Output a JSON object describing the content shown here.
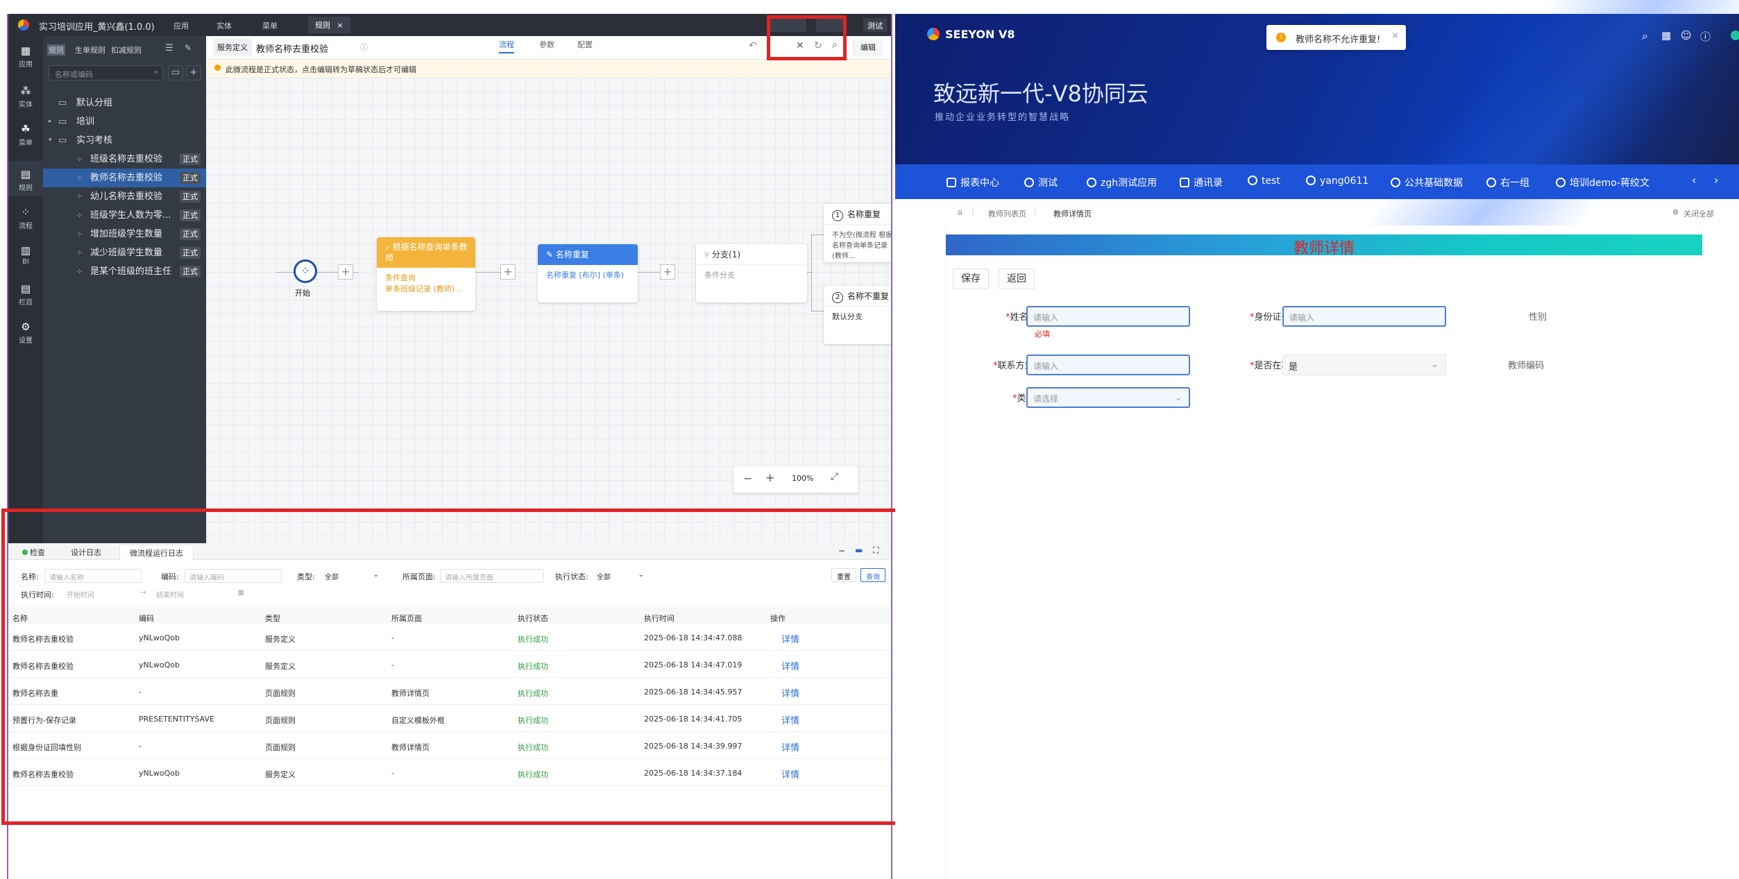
{
  "left_app": {
    "title": "实习培训应用_黄兴鑫(1.0.0)",
    "top_tabs": [
      "应用",
      "实体",
      "菜单",
      "规则"
    ],
    "active_top_tab": "规则",
    "top_right_btn": "测试",
    "rail": [
      "应用",
      "实体",
      "菜单",
      "规则",
      "流程",
      "BI",
      "栏目",
      "设置"
    ],
    "tree_tabs": [
      "规则",
      "生单规则",
      "扣减规则"
    ],
    "search_placeholder": "名称或编码",
    "groups": [
      "默认分组",
      "培训",
      "实习考核"
    ],
    "items": [
      {
        "label": "班级名称去重校验",
        "tag": "正式"
      },
      {
        "label": "教师名称去重校验",
        "tag": "正式"
      },
      {
        "label": "幼儿名称去重校验",
        "tag": "正式"
      },
      {
        "label": "班级学生人数为零...",
        "tag": "正式"
      },
      {
        "label": "增加班级学生数量",
        "tag": "正式"
      },
      {
        "label": "减少班级学生数量",
        "tag": "正式"
      },
      {
        "label": "是某个班级的班主任",
        "tag": "正式"
      }
    ]
  },
  "canvas": {
    "service_def": "服务定义",
    "name": "教师名称去重校验",
    "tabs": [
      "流程",
      "参数",
      "配置"
    ],
    "edit_btn": "编辑",
    "notice": "此微流程是正式状态，点击编辑转为草稿状态后才可编辑",
    "start_label": "开始",
    "node1_title": "根据名称查询单条教师",
    "node1_l1": "条件查询",
    "node1_l2": "单条班级记录 (教师)...",
    "node2_title": "名称重复",
    "node2_l1": "名称重复 [布尔] (单条)",
    "node3_title": "分支(1)",
    "node3_l1": "条件分支",
    "branch1_num": "1",
    "branch1_title": "名称重复",
    "branch1_body": "不为空(微流程 根据名称查询单条记录 (教师...",
    "branch2_num": "2",
    "branch2_title": "名称不重复",
    "branch2_body": "默认分支",
    "zoom": "100%"
  },
  "panel": {
    "tabs": [
      "检查",
      "设计日志",
      "微流程运行日志"
    ],
    "filters": {
      "name_label": "名称:",
      "name_ph": "请输入名称",
      "code_label": "编码:",
      "code_ph": "请输入编码",
      "type_label": "类型:",
      "type_val": "全部",
      "page_label": "所属页面:",
      "page_ph": "请输入所属页面",
      "status_label": "执行状态:",
      "status_val": "全部",
      "time_label": "执行时间:",
      "start_ph": "开始时间",
      "end_ph": "结束时间",
      "reset": "重置",
      "query": "查询"
    },
    "columns": [
      "名称",
      "编码",
      "类型",
      "所属页面",
      "执行状态",
      "执行时间",
      "操作"
    ],
    "rows": [
      [
        "教师名称去重校验",
        "yNLwoQob",
        "服务定义",
        "-",
        "执行成功",
        "2025-06-18 14:34:47.088",
        "详情"
      ],
      [
        "教师名称去重校验",
        "yNLwoQob",
        "服务定义",
        "-",
        "执行成功",
        "2025-06-18 14:34:47.019",
        "详情"
      ],
      [
        "教师名称去重",
        "-",
        "页面规则",
        "教师详情页",
        "执行成功",
        "2025-06-18 14:34:45.957",
        "详情"
      ],
      [
        "预置行为-保存记录",
        "PRESETENTITYSAVE",
        "页面规则",
        "自定义模板外框",
        "执行成功",
        "2025-06-18 14:34:41.705",
        "详情"
      ],
      [
        "根据身份证回填性别",
        "-",
        "页面规则",
        "教师详情页",
        "执行成功",
        "2025-06-18 14:34:39.997",
        "详情"
      ],
      [
        "教师名称去重校验",
        "yNLwoQob",
        "服务定义",
        "-",
        "执行成功",
        "2025-06-18 14:34:37.184",
        "详情"
      ]
    ]
  },
  "right_app": {
    "logo": "SEEYON V8",
    "toast": "教师名称不允许重复!",
    "hero_title": "致远新一代-V8协同云",
    "hero_sub": "推动企业业务转型的智慧战略",
    "nav": [
      "报表中心",
      "测试",
      "zgh测试应用",
      "通讯录",
      "test",
      "yang0611",
      "公共基础数据",
      "右一组",
      "培训demo-蒋绞文"
    ],
    "crumbs": [
      "教师列表页",
      "教师详情页"
    ],
    "close_all": "关闭全部",
    "banner": "教师详情",
    "save_btn": "保存",
    "back_btn": "返回",
    "form": {
      "name_label": "姓名",
      "name_ph": "请输入",
      "name_err": "必填",
      "id_label": "身份证号",
      "id_ph": "请输入",
      "gender_label": "性别",
      "phone_label": "联系方式",
      "phone_ph": "请输入",
      "employed_label": "是否在职",
      "employed_val": "是",
      "code_label": "教师编码",
      "type_label": "类别",
      "type_ph": "请选择"
    }
  }
}
